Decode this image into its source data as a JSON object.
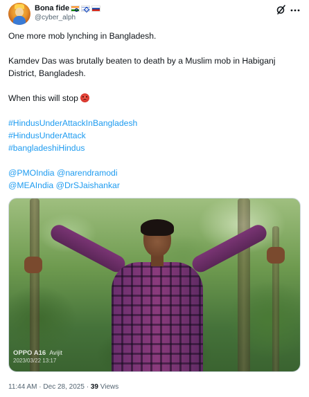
{
  "author": {
    "display_name": "Bona fide",
    "handle": "@cyber_alph",
    "flags": [
      "india-flag",
      "israel-flag",
      "russia-flag"
    ]
  },
  "tweet": {
    "line1": "One more mob lynching in Bangladesh.",
    "line2": "Kamdev Das was brutally beaten to death by a Muslim mob in Habiganj District, Bangladesh.",
    "line3": "When this will stop",
    "hashtags": [
      "#HindusUnderAttackInBangladesh",
      "#HindusUnderAttack",
      "#bangladeshiHindus"
    ],
    "mentions_line1": "@PMOIndia @narendramodi",
    "mentions_line2": "@MEAIndia @DrSJaishankar"
  },
  "media": {
    "watermark_brand": "OPPO A16",
    "watermark_extra": "Avijit",
    "watermark_date": "2023/03/22 13:17"
  },
  "meta": {
    "time": "11:44 AM",
    "separator": "·",
    "date": "Dec 28, 2025",
    "views_count": "39",
    "views_label": "Views"
  },
  "colors": {
    "link": "#1d9bf0",
    "text": "#0f1419",
    "secondary": "#536471"
  }
}
